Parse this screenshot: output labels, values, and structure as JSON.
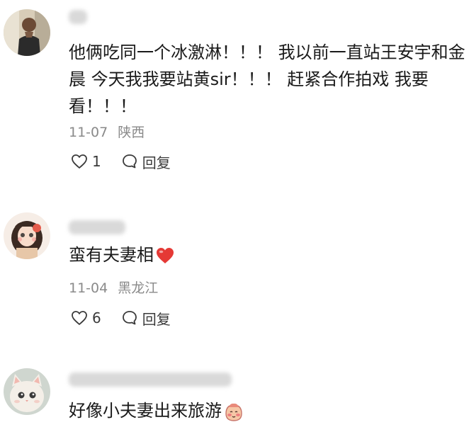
{
  "comments": [
    {
      "avatar_icon": "user-avatar-man-icon",
      "content_lines": [
        "他俩吃同一个冰激淋！！！  我以前一直站王安宇和金",
        "晨 今天我我要站黄sir！！！ 赶紧合作拍戏 我要",
        "看！！！"
      ],
      "date": "11-07",
      "location": "陕西",
      "like_count": "1",
      "reply_label": "回复"
    },
    {
      "avatar_icon": "user-avatar-girl-icon",
      "content_text": "蛮有夫妻相",
      "content_emoji": "red-heart-icon",
      "date": "11-04",
      "location": "黑龙江",
      "like_count": "6",
      "reply_label": "回复"
    },
    {
      "avatar_icon": "user-avatar-cat-icon",
      "content_text": "好像小夫妻出来旅游",
      "content_emoji": "blushing-face-emoji-icon"
    }
  ],
  "colors": {
    "text": "#1a1a1a",
    "meta": "#8a8a8a",
    "heart": "#e53935"
  }
}
